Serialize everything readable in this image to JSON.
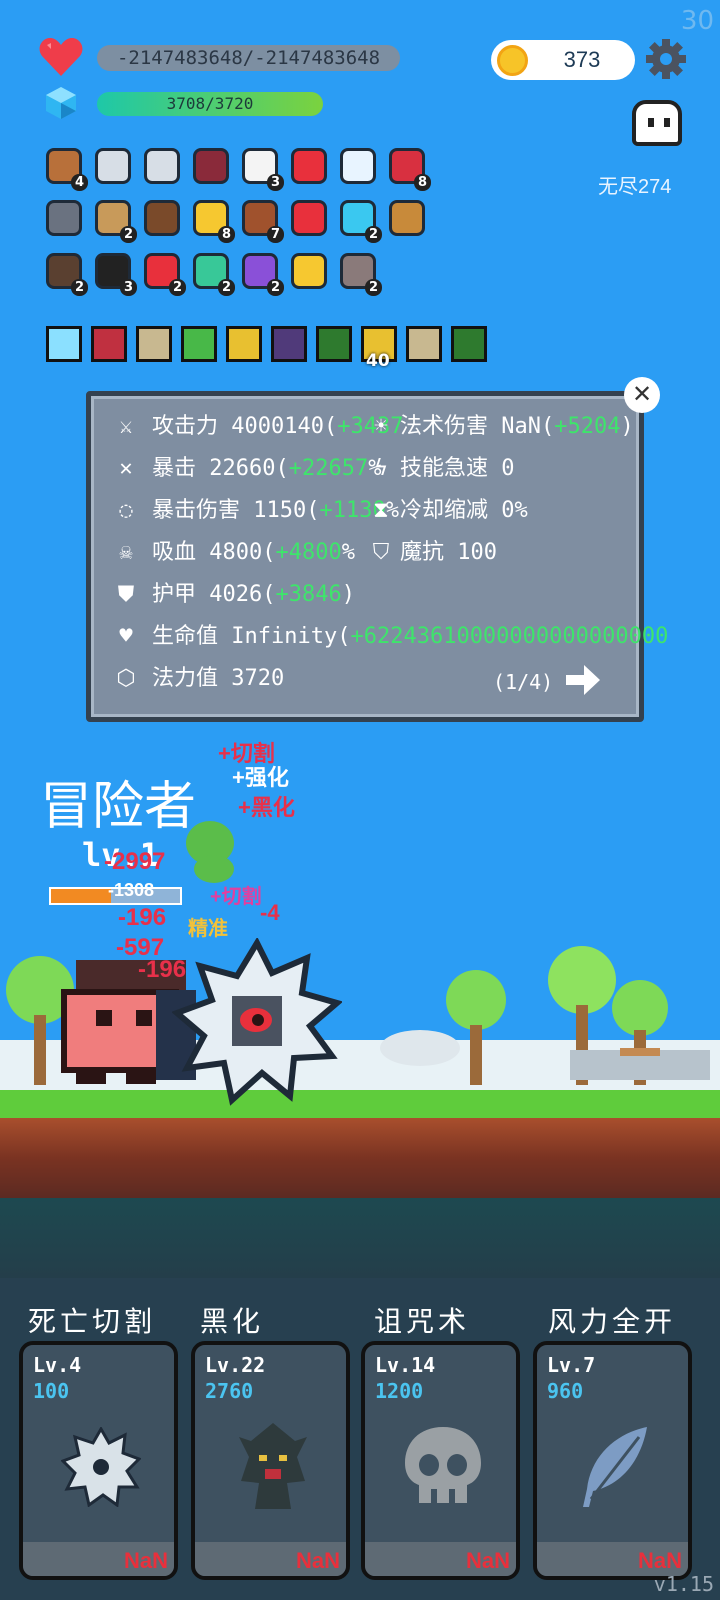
{
  "fps": "30",
  "hud": {
    "hp_text": "-2147483648/-2147483648",
    "mp_text": "3708/3720",
    "gold": "373",
    "endless_label": "无尽274"
  },
  "items": [
    {
      "icon": "shield-icon",
      "count": "4"
    },
    {
      "icon": "sword-icon",
      "count": ""
    },
    {
      "icon": "sword-icon",
      "count": ""
    },
    {
      "icon": "jar-icon",
      "count": ""
    },
    {
      "icon": "dice-icon",
      "count": "3"
    },
    {
      "icon": "strawberry-icon",
      "count": ""
    },
    {
      "icon": "wing-icon",
      "count": ""
    },
    {
      "icon": "red-shield-icon",
      "count": "8"
    },
    {
      "icon": "helmet-icon",
      "count": ""
    },
    {
      "icon": "arrows-icon",
      "count": "2"
    },
    {
      "icon": "coconut-icon",
      "count": ""
    },
    {
      "icon": "sunflower-icon",
      "count": "8"
    },
    {
      "icon": "potion-icon",
      "count": "7"
    },
    {
      "icon": "hearts-icon",
      "count": ""
    },
    {
      "icon": "gem-icon",
      "count": "2"
    },
    {
      "icon": "bow-icon",
      "count": ""
    },
    {
      "icon": "hook-icon",
      "count": "2"
    },
    {
      "icon": "cauldron-icon",
      "count": "3"
    },
    {
      "icon": "pill-icon",
      "count": "2"
    },
    {
      "icon": "flask-icon",
      "count": "2"
    },
    {
      "icon": "crystal-ball-icon",
      "count": "2"
    },
    {
      "icon": "magic-wand-icon",
      "count": ""
    },
    {
      "icon": "tombstone-icon",
      "count": "2"
    }
  ],
  "buffs": [
    {
      "icon": "light-burst-icon",
      "count": ""
    },
    {
      "icon": "blade-icon",
      "count": ""
    },
    {
      "icon": "shield-icon",
      "count": ""
    },
    {
      "icon": "check-icon",
      "count": ""
    },
    {
      "icon": "skull-icon",
      "count": ""
    },
    {
      "icon": "demon-icon",
      "count": ""
    },
    {
      "icon": "rune-icon",
      "count": ""
    },
    {
      "icon": "skull-gold-icon",
      "count": "40"
    },
    {
      "icon": "shield-icon",
      "count": ""
    },
    {
      "icon": "rune-icon",
      "count": ""
    }
  ],
  "stats": {
    "attack": {
      "label": "攻击力",
      "value": "4000140(",
      "plus": "+3437"
    },
    "spell_damage": {
      "label": "法术伤害",
      "value": "NaN(",
      "plus": "+5204",
      "close": ")"
    },
    "crit": {
      "label": "暴击",
      "value": "22660(",
      "plus": "+22657",
      "suffix": "%"
    },
    "skill_haste": {
      "label": "技能急速",
      "value": "0"
    },
    "crit_damage": {
      "label": "暴击伤害",
      "value": "1150(",
      "plus": "+1130",
      "suffix": "%"
    },
    "cooldown": {
      "label": "冷却缩减",
      "value": "0%"
    },
    "lifesteal": {
      "label": "吸血",
      "value": "4800(",
      "plus": "+4800",
      "suffix": "%"
    },
    "magic_resist": {
      "label": "魔抗",
      "value": "100"
    },
    "armor": {
      "label": "护甲",
      "value": "4026(",
      "plus": "+3846",
      "close": ")"
    },
    "health": {
      "label": "生命值",
      "value": "Infinity(",
      "plus": "+62243610000000000000000"
    },
    "mana": {
      "label": "法力值",
      "value": "3720"
    },
    "page": "(1/4)"
  },
  "hero": {
    "name": "冒险者",
    "level": "lv.1"
  },
  "floaters": [
    {
      "text": "+切割",
      "color": "#e8304a"
    },
    {
      "text": "+强化",
      "color": "#ffffff"
    },
    {
      "text": "+黑化",
      "color": "#e8304a"
    },
    {
      "text": "-2997",
      "color": "#e8304a"
    },
    {
      "text": "-1308",
      "color": "#ffffff"
    },
    {
      "text": "-196",
      "color": "#e8304a"
    },
    {
      "text": "-597",
      "color": "#e8304a"
    },
    {
      "text": "-196",
      "color": "#e8304a"
    },
    {
      "text": "+切割",
      "color": "#e040a0"
    },
    {
      "text": "精准",
      "color": "#f2c23a"
    },
    {
      "text": "-4",
      "color": "#e8304a"
    }
  ],
  "skills": [
    {
      "name": "死亡切割",
      "level": "Lv.4",
      "cost": "100",
      "status": "NaN",
      "icon": "saw-blade-icon"
    },
    {
      "name": "黑化",
      "level": "Lv.22",
      "cost": "2760",
      "status": "NaN",
      "icon": "dark-tree-icon"
    },
    {
      "name": "诅咒术",
      "level": "Lv.14",
      "cost": "1200",
      "status": "NaN",
      "icon": "skull-icon"
    },
    {
      "name": "风力全开",
      "level": "Lv.7",
      "cost": "960",
      "status": "NaN",
      "icon": "feather-icon"
    }
  ],
  "version": "v1.15"
}
